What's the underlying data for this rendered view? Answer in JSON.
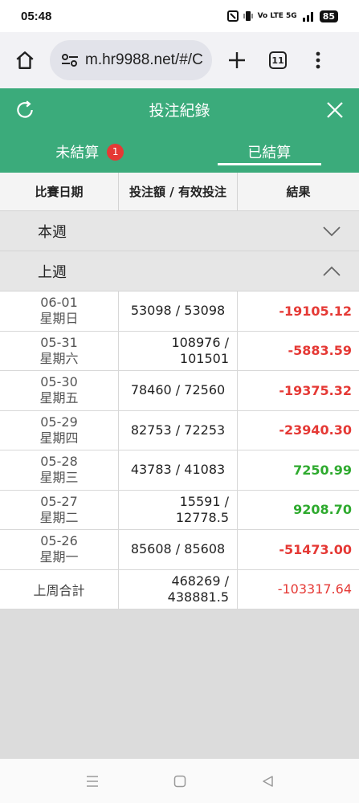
{
  "status": {
    "time": "05:48",
    "network": "Vo LTE 5G",
    "battery": "85"
  },
  "browser": {
    "url": "m.hr9988.net/#/C",
    "tab_count": "11"
  },
  "header": {
    "title": "投注紀錄"
  },
  "tabs": [
    {
      "label": "未結算",
      "badge": "1"
    },
    {
      "label": "已結算"
    }
  ],
  "columns": {
    "date": "比賽日期",
    "bet": "投注額 / 有效投注",
    "result": "結果"
  },
  "weeks": {
    "this_week": "本週",
    "last_week": "上週"
  },
  "rows": [
    {
      "date": "06-01",
      "day": "星期日",
      "bet_line1": "53098 / 53098",
      "bet_line2": "",
      "result": "-19105.12"
    },
    {
      "date": "05-31",
      "day": "星期六",
      "bet_line1": "108976 /",
      "bet_line2": "101501",
      "result": "-5883.59"
    },
    {
      "date": "05-30",
      "day": "星期五",
      "bet_line1": "78460 / 72560",
      "bet_line2": "",
      "result": "-19375.32"
    },
    {
      "date": "05-29",
      "day": "星期四",
      "bet_line1": "82753 / 72253",
      "bet_line2": "",
      "result": "-23940.30"
    },
    {
      "date": "05-28",
      "day": "星期三",
      "bet_line1": "43783 / 41083",
      "bet_line2": "",
      "result": "7250.99"
    },
    {
      "date": "05-27",
      "day": "星期二",
      "bet_line1": "15591 /",
      "bet_line2": "12778.5",
      "result": "9208.70"
    },
    {
      "date": "05-26",
      "day": "星期一",
      "bet_line1": "85608 / 85608",
      "bet_line2": "",
      "result": "-51473.00"
    }
  ],
  "total": {
    "label": "上周合計",
    "bet_line1": "468269 /",
    "bet_line2": "438881.5",
    "result": "-103317.64"
  },
  "colors": {
    "brand_green": "#3bab7b",
    "negative": "#e53935",
    "positive": "#2eaa2e"
  }
}
